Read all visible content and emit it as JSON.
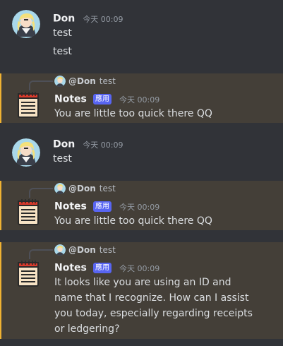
{
  "messages": [
    {
      "author": "Don",
      "time": "今天 00:09",
      "lines": [
        "test",
        "test"
      ]
    },
    {
      "reply": {
        "author": "@Don",
        "text": "test"
      },
      "author": "Notes",
      "badge": "應用",
      "time": "今天 00:09",
      "text": "You are little too quick there QQ"
    },
    {
      "author": "Don",
      "time": "今天 00:09",
      "lines": [
        "test"
      ]
    },
    {
      "reply": {
        "author": "@Don",
        "text": "test"
      },
      "author": "Notes",
      "badge": "應用",
      "time": "今天 00:09",
      "text": "You are little too quick there QQ"
    },
    {
      "reply": {
        "author": "@Don",
        "text": "test"
      },
      "author": "Notes",
      "badge": "應用",
      "time": "今天 00:09",
      "text": "It looks like you are using an ID and name that I recognize. How can I assist you today, especially regarding receipts or ledgering?"
    }
  ],
  "colors": {
    "background": "#313338",
    "highlight": "#443f38",
    "highlight_border": "#f0b232",
    "badge": "#5865f2"
  }
}
